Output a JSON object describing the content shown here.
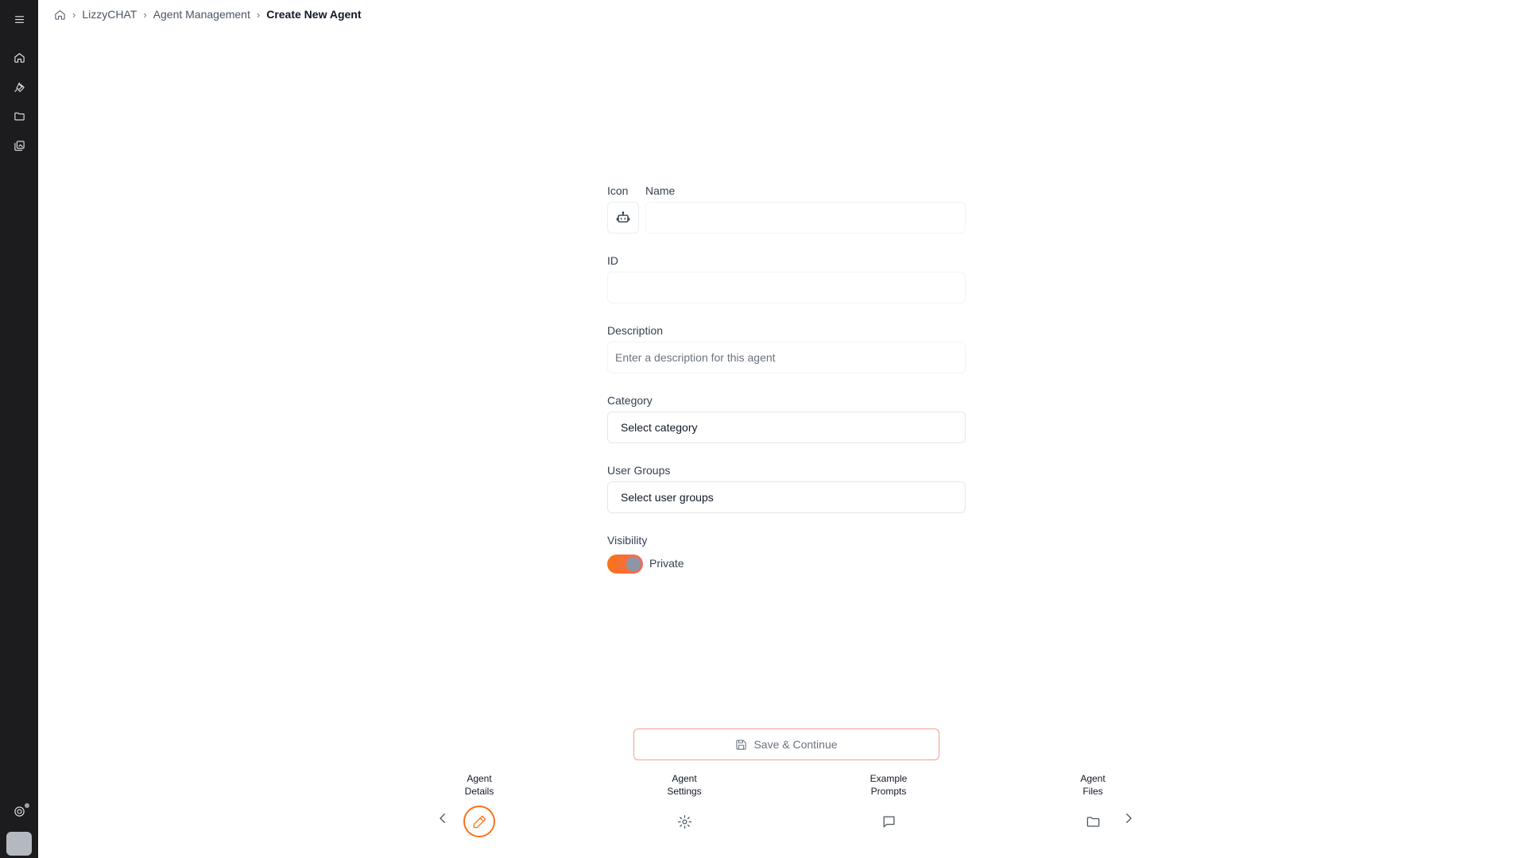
{
  "sidebar": {
    "items": [
      {
        "name": "menu-icon"
      },
      {
        "name": "home-icon"
      },
      {
        "name": "wrench-icon"
      },
      {
        "name": "folder-icon"
      },
      {
        "name": "gallery-icon"
      }
    ],
    "bottom": [
      {
        "name": "support-icon"
      },
      {
        "name": "avatar"
      }
    ]
  },
  "breadcrumb": {
    "home_icon": "home-icon",
    "items": [
      "LizzyCHAT",
      "Agent Management",
      "Create New Agent"
    ],
    "separator": "›"
  },
  "form": {
    "icon_label": "Icon",
    "icon_value": "bot-icon",
    "name_label": "Name",
    "name_value": "",
    "id_label": "ID",
    "id_value": "",
    "description_label": "Description",
    "description_value": "",
    "description_placeholder": "Enter a description for this agent",
    "category_label": "Category",
    "category_value": "Select category",
    "user_groups_label": "User Groups",
    "user_groups_value": "Select user groups",
    "visibility_label": "Visibility",
    "visibility_value": "Private",
    "visibility_toggle_on": true
  },
  "actions": {
    "save_label": "Save & Continue"
  },
  "steps": {
    "items": [
      {
        "label": "Agent\nDetails",
        "icon": "pencil-icon",
        "active": true
      },
      {
        "label": "Agent\nSettings",
        "icon": "gear-icon",
        "active": false
      },
      {
        "label": "Example\nPrompts",
        "icon": "chat-icon",
        "active": false
      },
      {
        "label": "Agent\nFiles",
        "icon": "folder-icon",
        "active": false
      }
    ]
  },
  "colors": {
    "accent": "#f97316",
    "sidebar_bg": "#1c1c1e",
    "save_border": "#f4a08c"
  }
}
